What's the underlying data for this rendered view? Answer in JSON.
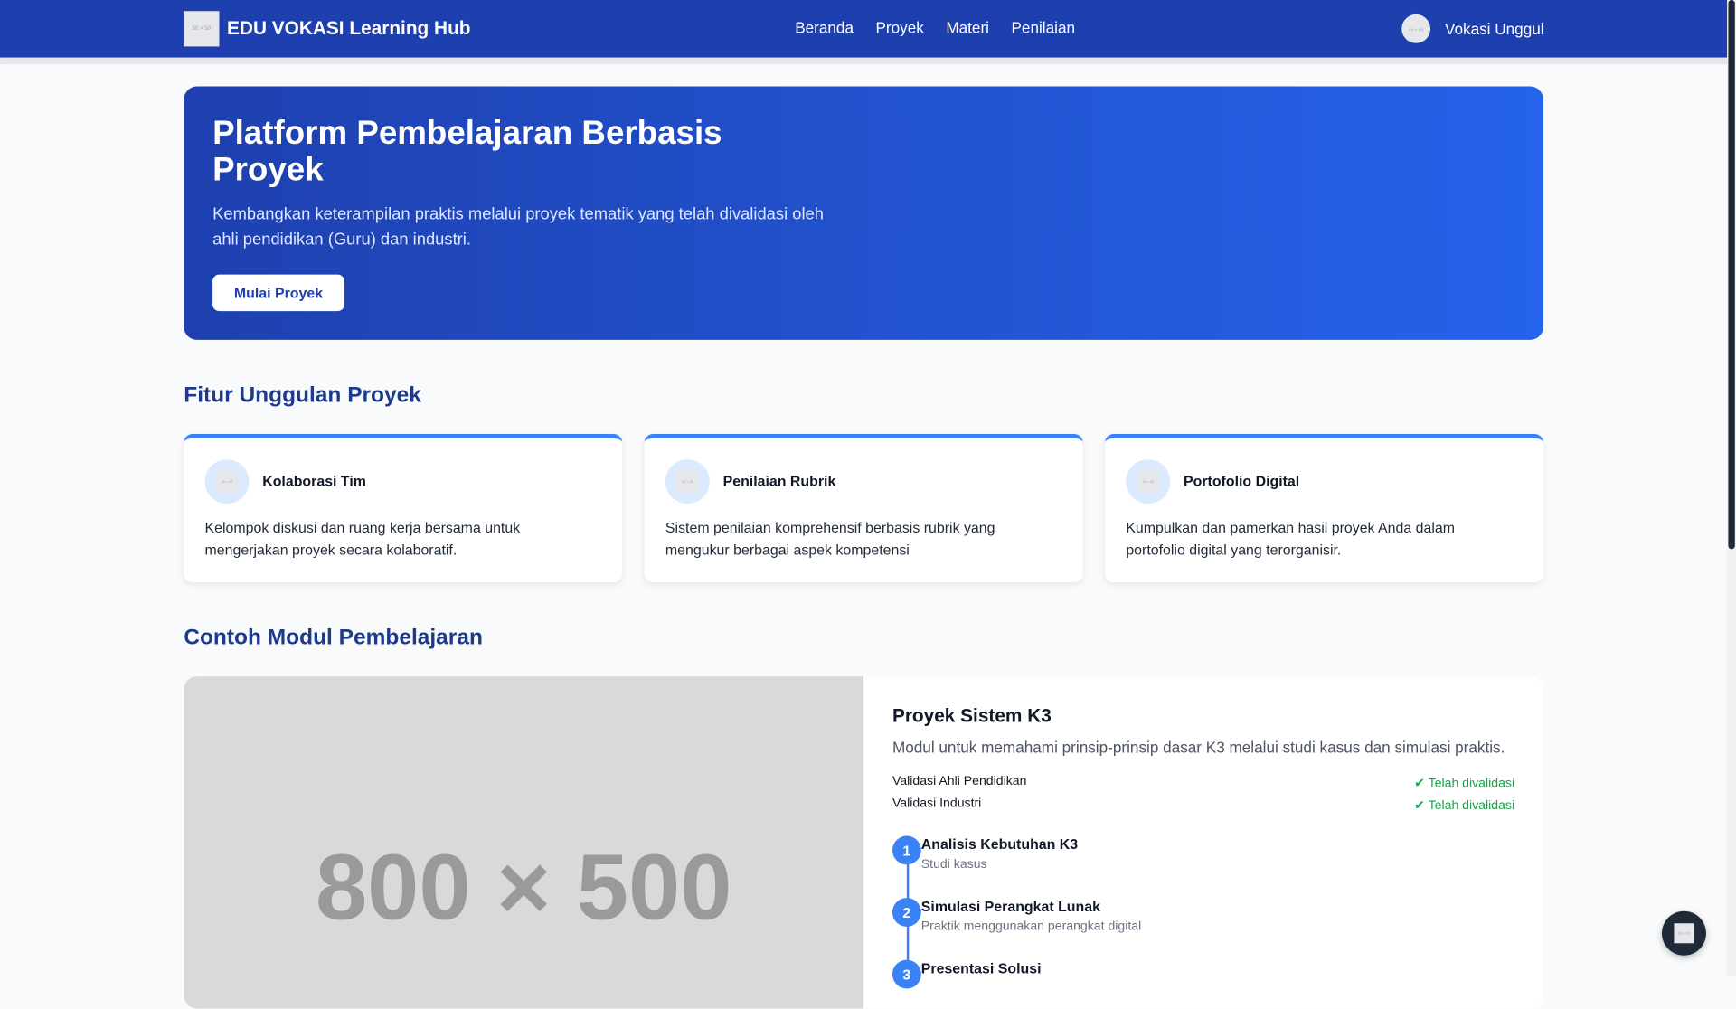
{
  "navbar": {
    "logo_text": "50 × 50",
    "brand": "EDU VOKASI Learning Hub",
    "links": [
      "Beranda",
      "Proyek",
      "Materi",
      "Penilaian"
    ],
    "avatar_text": "40 × 40",
    "user_name": "Vokasi Unggul"
  },
  "hero": {
    "title": "Platform Pembelajaran Berbasis Proyek",
    "description": "Kembangkan keterampilan praktis melalui proyek tematik yang telah divalidasi oleh ahli pendidikan (Guru) dan industri.",
    "button": "Mulai Proyek"
  },
  "features": {
    "heading": "Fitur Unggulan Proyek",
    "icon_text": "30 × 30",
    "items": [
      {
        "title": "Kolaborasi Tim",
        "description": "Kelompok diskusi dan ruang kerja bersama untuk mengerjakan proyek secara kolaboratif."
      },
      {
        "title": "Penilaian Rubrik",
        "description": "Sistem penilaian komprehensif berbasis rubrik yang mengukur berbagai aspek kompetensi"
      },
      {
        "title": "Portofolio Digital",
        "description": "Kumpulkan dan pamerkan hasil proyek Anda dalam portofolio digital yang terorganisir."
      }
    ]
  },
  "modules": {
    "heading": "Contoh Modul Pembelajaran",
    "image_text": "800 × 500",
    "title": "Proyek Sistem K3",
    "description": "Modul untuk memahami prinsip-prinsip dasar K3 melalui studi kasus dan simulasi praktis.",
    "validations": [
      {
        "label": "Validasi Ahli Pendidikan",
        "status": "Telah divalidasi"
      },
      {
        "label": "Validasi Industri",
        "status": "Telah divalidasi"
      }
    ],
    "check_mark": "✔",
    "steps": [
      {
        "num": "1",
        "title": "Analisis Kebutuhan K3",
        "sub": "Studi kasus"
      },
      {
        "num": "2",
        "title": "Simulasi Perangkat Lunak",
        "sub": "Praktik menggunakan perangkat digital"
      },
      {
        "num": "3",
        "title": "Presentasi Solusi",
        "sub": ""
      }
    ]
  },
  "float_button": {
    "icon_text": "30 × 30"
  }
}
